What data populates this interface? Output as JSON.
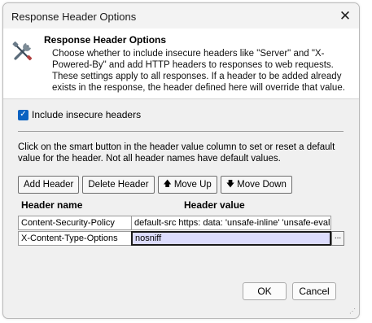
{
  "window": {
    "title": "Response Header Options",
    "close_glyph": "✕"
  },
  "header": {
    "icon": "tools-icon",
    "title": "Response Header Options",
    "description": "Choose whether to include insecure headers like \"Server\" and \"X-Powered-By\" and add HTTP headers to responses to web requests. These settings apply to all responses. If a header to be added already exists in the response, the header defined here will override that value."
  },
  "insecure_headers": {
    "label": "Include insecure headers",
    "checked": true
  },
  "instructions": "Click on the smart button in the header value column to set or reset a default value for the header. Not all header names have default values.",
  "toolbar": {
    "add_label": "Add Header",
    "delete_label": "Delete Header",
    "move_up_label": "Move Up",
    "move_down_label": "Move Down"
  },
  "grid": {
    "columns": [
      "Header name",
      "Header value"
    ],
    "rows": [
      {
        "name": "Content-Security-Policy",
        "value": "default-src https: data: 'unsafe-inline' 'unsafe-eval'"
      },
      {
        "name": "X-Content-Type-Options",
        "value": "nosniff",
        "editing": true,
        "smart_button": "..."
      }
    ]
  },
  "footer": {
    "ok_label": "OK",
    "cancel_label": "Cancel"
  },
  "colors": {
    "accent": "#0a62c1",
    "edit_cell_bg": "#dcdcfc"
  }
}
